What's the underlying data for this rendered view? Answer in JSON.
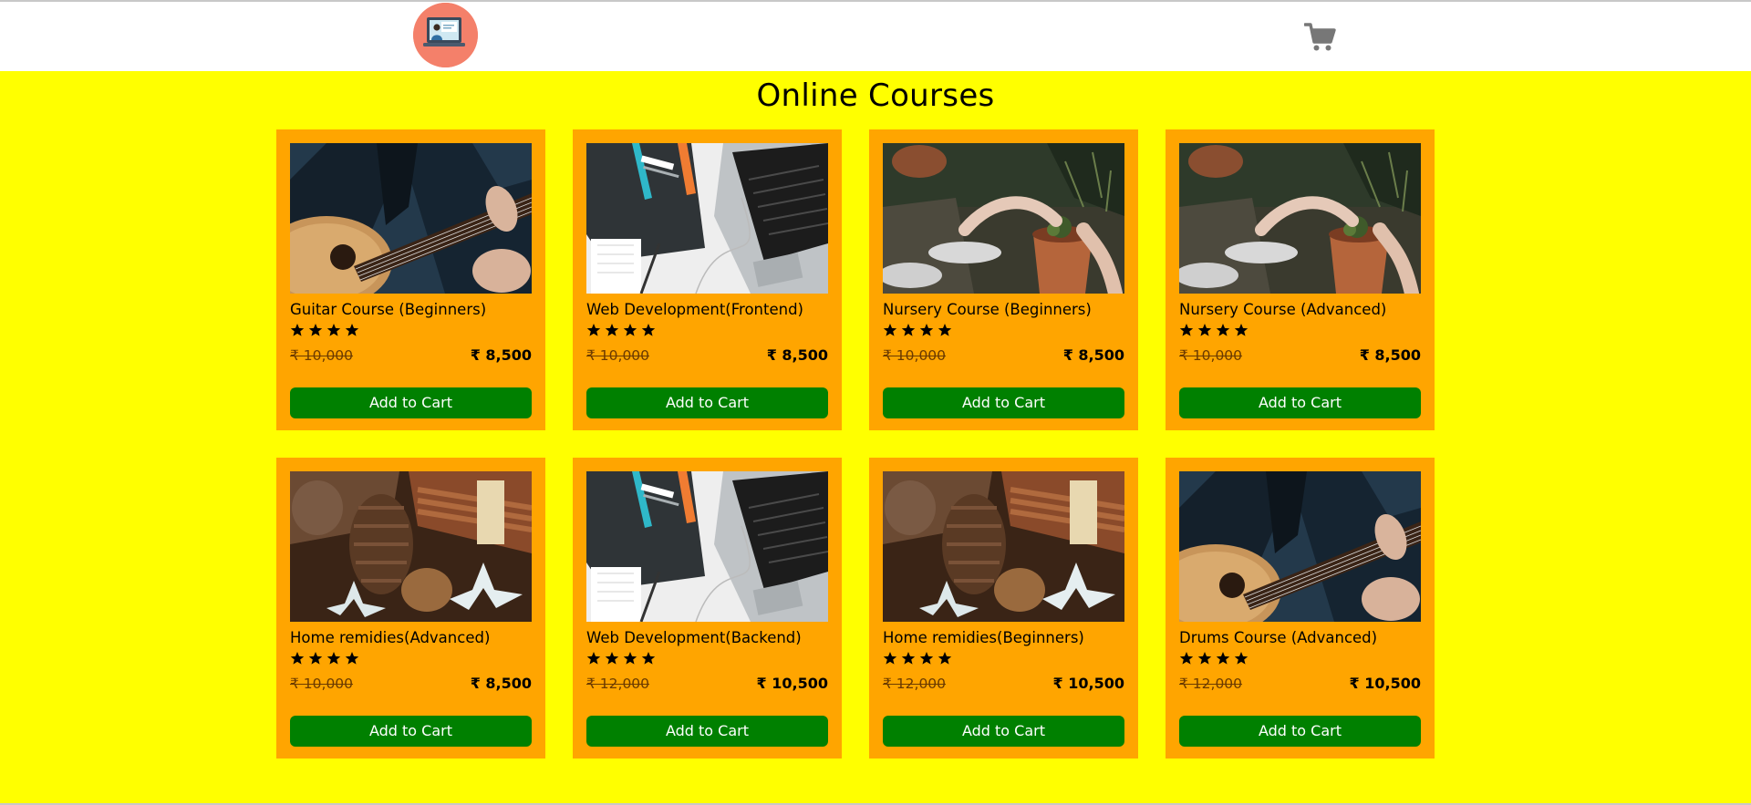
{
  "header": {
    "logo_icon": "teacher-laptop-logo-icon",
    "cart_icon": "shopping-cart-icon"
  },
  "main": {
    "title": "Online Courses"
  },
  "courses": [
    {
      "title": "Guitar Course (Beginners)",
      "rating": 4,
      "old_price": "₹ 10,000",
      "new_price": "₹ 8,500",
      "image": "guitar-photo",
      "button": "Add to Cart"
    },
    {
      "title": "Web Development(Frontend)",
      "rating": 4,
      "old_price": "₹ 10,000",
      "new_price": "₹ 8,500",
      "image": "laptop-htmlcss-photo",
      "button": "Add to Cart"
    },
    {
      "title": "Nursery Course (Beginners)",
      "rating": 4,
      "old_price": "₹ 10,000",
      "new_price": "₹ 8,500",
      "image": "potted-plant-photo",
      "button": "Add to Cart"
    },
    {
      "title": "Nursery Course (Advanced)",
      "rating": 4,
      "old_price": "₹ 10,000",
      "new_price": "₹ 8,500",
      "image": "potted-plant-photo",
      "button": "Add to Cart"
    },
    {
      "title": "Home remidies(Advanced)",
      "rating": 4,
      "old_price": "₹ 10,000",
      "new_price": "₹ 8,500",
      "image": "spices-photo",
      "button": "Add to Cart"
    },
    {
      "title": "Web Development(Backend)",
      "rating": 4,
      "old_price": "₹ 12,000",
      "new_price": "₹ 10,500",
      "image": "laptop-htmlcss-photo",
      "button": "Add to Cart"
    },
    {
      "title": "Home remidies(Beginners)",
      "rating": 4,
      "old_price": "₹ 12,000",
      "new_price": "₹ 10,500",
      "image": "spices-photo",
      "button": "Add to Cart"
    },
    {
      "title": "Drums Course (Advanced)",
      "rating": 4,
      "old_price": "₹ 12,000",
      "new_price": "₹ 10,500",
      "image": "guitar-photo",
      "button": "Add to Cart"
    }
  ],
  "colors": {
    "page_background": "#ffff00",
    "card_background": "#ffa500",
    "button_background": "#008000",
    "logo_background": "#f4806a"
  }
}
